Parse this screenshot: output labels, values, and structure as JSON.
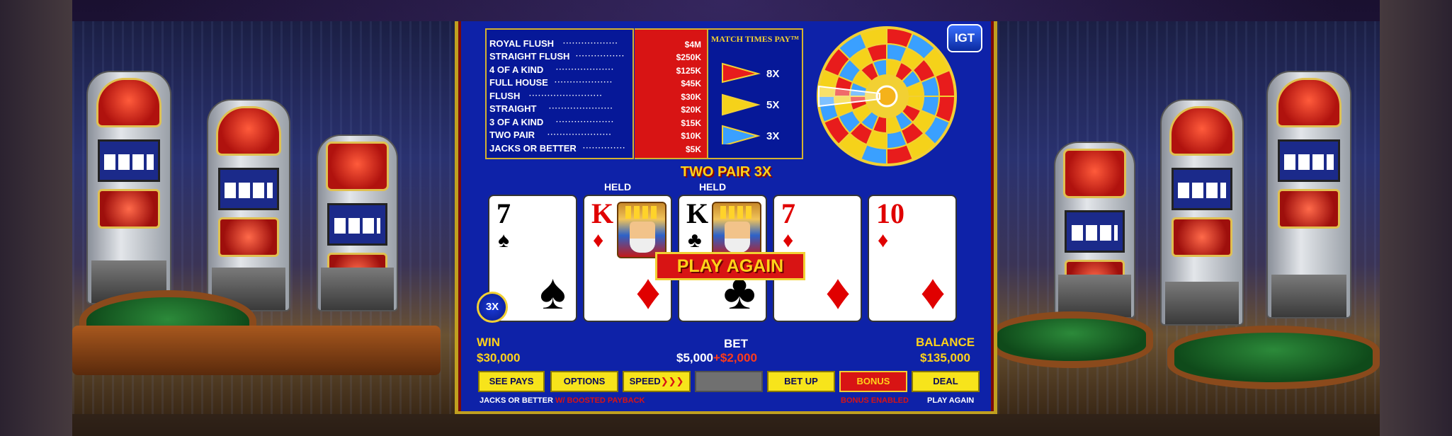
{
  "paytable": [
    {
      "hand": "ROYAL FLUSH",
      "pay": "$4M"
    },
    {
      "hand": "STRAIGHT FLUSH",
      "pay": "$250K"
    },
    {
      "hand": "4 OF A KIND",
      "pay": "$125K"
    },
    {
      "hand": "FULL HOUSE",
      "pay": "$45K"
    },
    {
      "hand": "FLUSH",
      "pay": "$30K"
    },
    {
      "hand": "STRAIGHT",
      "pay": "$20K"
    },
    {
      "hand": "3 OF A KIND",
      "pay": "$15K"
    },
    {
      "hand": "TWO PAIR",
      "pay": "$10K"
    },
    {
      "hand": "JACKS OR BETTER",
      "pay": "$5K"
    }
  ],
  "match": {
    "title": "MATCH TIMES PAY™",
    "multipliers": [
      "8X",
      "5X",
      "3X"
    ],
    "colors": [
      "#e81c1c",
      "#f5d21a",
      "#3aa0ff"
    ]
  },
  "logo": "IGT",
  "status": "TWO PAIR 3X",
  "held_label": "HELD",
  "cards": [
    {
      "rank": "7",
      "suit": "♠",
      "color": "black",
      "held": false,
      "face": false
    },
    {
      "rank": "K",
      "suit": "♦",
      "color": "red",
      "held": true,
      "face": true
    },
    {
      "rank": "K",
      "suit": "♣",
      "color": "black",
      "held": true,
      "face": true
    },
    {
      "rank": "7",
      "suit": "♦",
      "color": "red",
      "held": false,
      "face": false
    },
    {
      "rank": "10",
      "suit": "♦",
      "color": "red",
      "held": false,
      "face": false
    }
  ],
  "play_again_banner": "PLAY AGAIN",
  "multiplier_badge": "3X",
  "win": {
    "label": "WIN",
    "value": "$30,000"
  },
  "bet": {
    "label": "BET",
    "value": "$5,000",
    "extra": "+$2,000"
  },
  "balance": {
    "label": "BALANCE",
    "value": "$135,000"
  },
  "buttons": {
    "see_pays": "SEE PAYS",
    "options": "OPTIONS",
    "speed": "SPEED",
    "speed_arrows": "❯❯❯",
    "bet_up": "BET UP",
    "bonus": "BONUS",
    "deal": "DEAL"
  },
  "footer": {
    "game": "JACKS OR BETTER",
    "paybacks": "W/ BOOSTED PAYBACK",
    "bonus_status": "BONUS ENABLED",
    "deal_hint": "PLAY AGAIN"
  }
}
